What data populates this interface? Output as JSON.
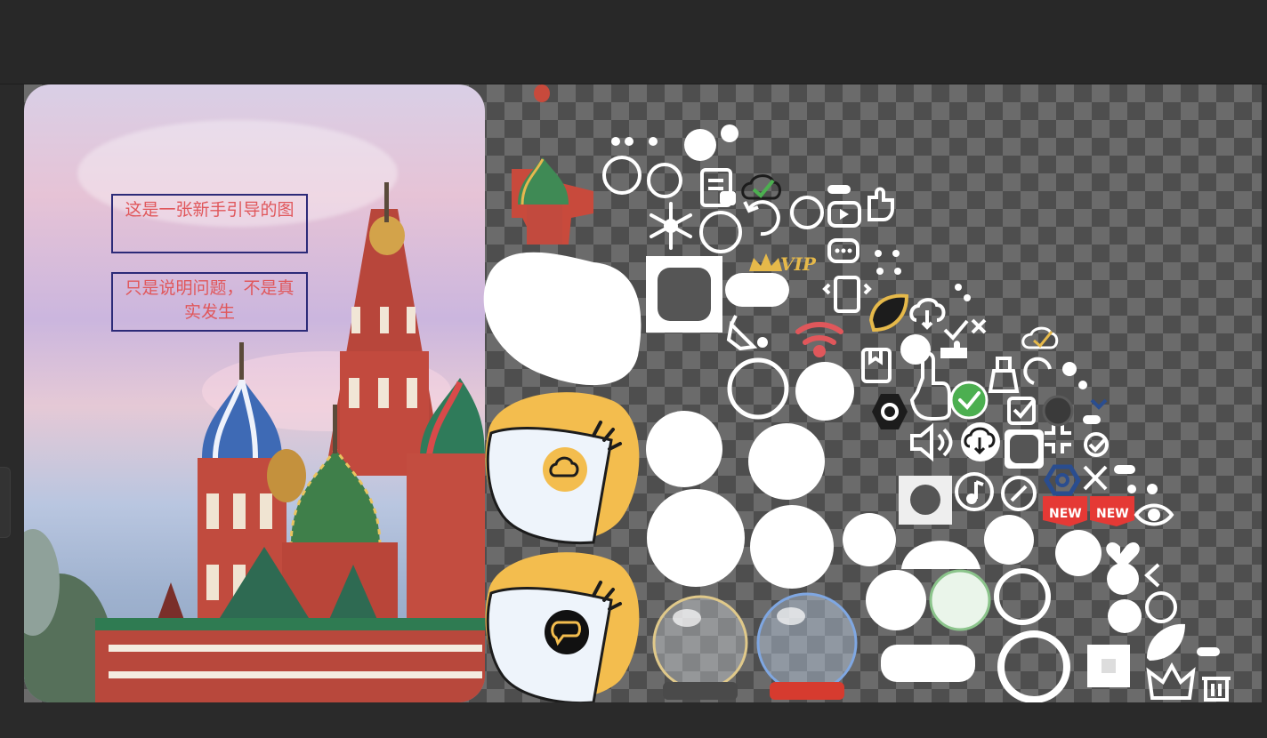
{
  "guide_image": {
    "note_1": "这是一张新手引导的图",
    "note_2": "只是说明问题，不是真实发生"
  },
  "badges": {
    "vip": "VIP",
    "new_1": "NEW",
    "new_2": "NEW"
  },
  "colors": {
    "workspace_bg": "#2a2a2a",
    "checker_light": "#6b6b6b",
    "checker_dark": "#4e4e4e",
    "note_text": "#e0575b",
    "note_border": "#2c2a78",
    "accent_yellow": "#f3bd4e",
    "success_green": "#4caf50",
    "wifi_red": "#e0575b",
    "new_red": "#e53935",
    "gear_blue": "#2a4d8f"
  },
  "icons": [
    "cathedral-image",
    "blob-shape",
    "yellow-card-cloud-icon",
    "yellow-card-chat-icon",
    "snowflake-icon",
    "vip-crown-icon",
    "wifi-icon",
    "paint-bucket-icon",
    "bookmark-icon",
    "hexagon-nut-icon",
    "touch-hand-icon",
    "check-circle-icon",
    "speaker-icon",
    "cloud-download-icon",
    "music-note-icon",
    "discount-icon",
    "checkbox-icon",
    "gear-icon",
    "heart-broken-icon",
    "eye-icon",
    "crown-icon",
    "trash-icon",
    "snow-globe-gold",
    "snow-globe-red",
    "refresh-icon",
    "phone-vibrate-icon",
    "note-lock-icon",
    "youtube-icon",
    "chat-bubbles-icon",
    "broom-icon"
  ]
}
